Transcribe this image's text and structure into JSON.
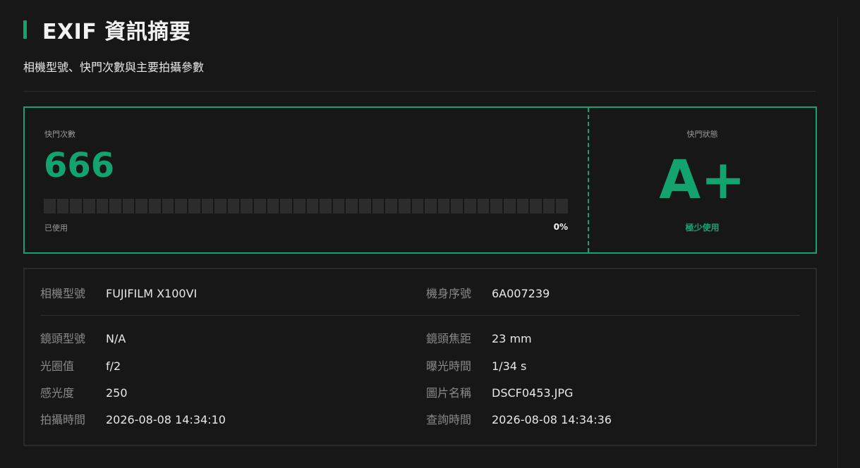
{
  "header": {
    "title": "EXIF 資訊摘要",
    "subtitle": "相機型號、快門次數與主要拍攝參數"
  },
  "shutter": {
    "count_label": "快門次數",
    "count_value": "666",
    "used_label": "已使用",
    "used_percent_text": "0%",
    "used_fraction": 0,
    "status_label": "快門狀態",
    "status_grade": "A+",
    "status_note": "極少使用",
    "accent_color": "#13a36f",
    "track_color": "#2c2c2c"
  },
  "exif": {
    "camera_model": {
      "label": "相機型號",
      "value": "FUJIFILM X100VI"
    },
    "serial": {
      "label": "機身序號",
      "value": "6A007239"
    },
    "lens_model": {
      "label": "鏡頭型號",
      "value": "N/A"
    },
    "focal_length": {
      "label": "鏡頭焦距",
      "value": "23 mm"
    },
    "aperture": {
      "label": "光圈值",
      "value": "f/2"
    },
    "exposure": {
      "label": "曝光時間",
      "value": "1/34 s"
    },
    "iso": {
      "label": "感光度",
      "value": "250"
    },
    "filename": {
      "label": "圖片名稱",
      "value": "DSCF0453.JPG"
    },
    "taken_at": {
      "label": "拍攝時間",
      "value": "2026-08-08 14:34:10"
    },
    "queried_at": {
      "label": "查詢時間",
      "value": "2026-08-08 14:34:36"
    }
  }
}
